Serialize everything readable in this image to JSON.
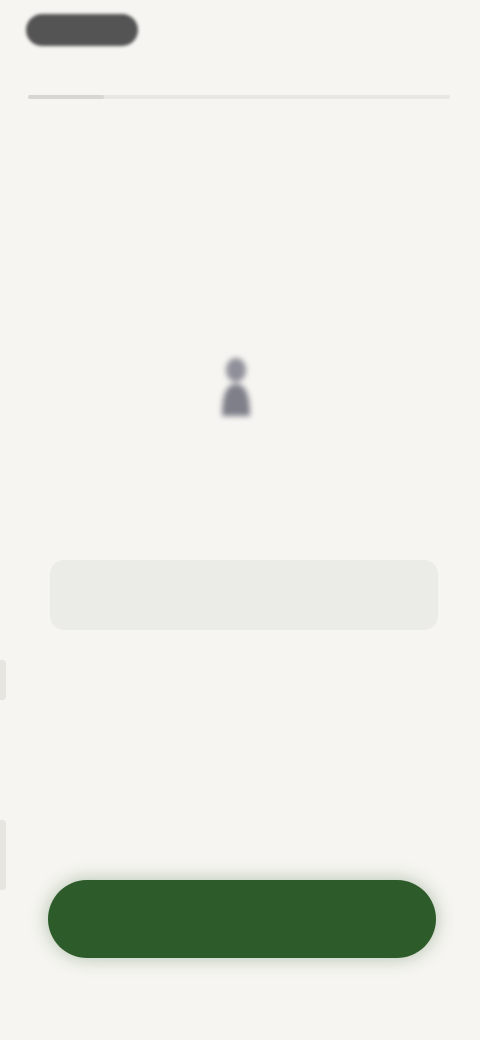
{
  "header": {
    "back_label": "",
    "progress_fraction": 0.18
  },
  "main": {
    "caption": "",
    "question": "",
    "input": {
      "value": "",
      "placeholder": ""
    }
  },
  "footer": {
    "continue_label": ""
  },
  "colors": {
    "background": "#f6f5f1",
    "accent": "#2e5b2a",
    "input_bg": "#ebebe8",
    "text_dark": "#545454"
  }
}
